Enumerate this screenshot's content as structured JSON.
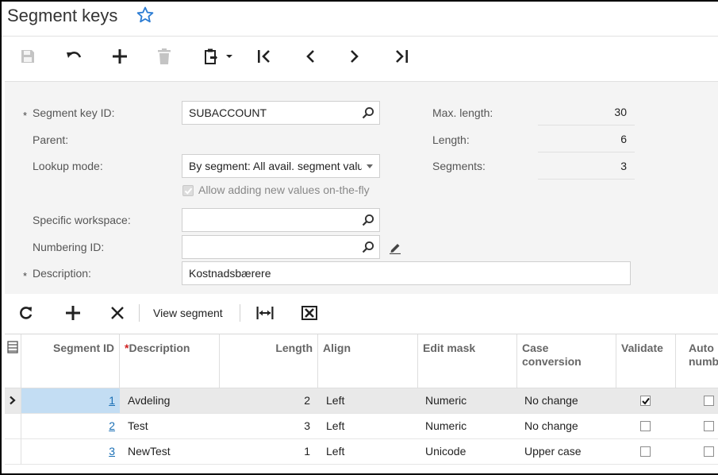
{
  "page": {
    "title": "Segment keys",
    "favorite_icon": "star-outline-icon"
  },
  "toolbar": {
    "buttons": [
      "save-icon",
      "undo-icon",
      "add-icon",
      "delete-icon",
      "clipboard-icon",
      "first-record-icon",
      "previous-record-icon",
      "next-record-icon",
      "last-record-icon"
    ]
  },
  "form": {
    "segment_key_id_label": "Segment key ID:",
    "segment_key_id_value": "SUBACCOUNT",
    "parent_label": "Parent:",
    "lookup_mode_label": "Lookup mode:",
    "lookup_mode_value": "By segment: All avail. segment values",
    "allow_new_values_label": "Allow adding new values on-the-fly",
    "allow_new_values_checked": true,
    "specific_workspace_label": "Specific workspace:",
    "specific_workspace_value": "",
    "numbering_id_label": "Numbering ID:",
    "numbering_id_value": "",
    "description_label": "Description:",
    "description_value": "Kostnadsbærere",
    "required_marker": "*",
    "max_length_label": "Max. length:",
    "max_length_value": "30",
    "length_label": "Length:",
    "length_value": "6",
    "segments_label": "Segments:",
    "segments_value": "3"
  },
  "grid_toolbar": {
    "view_segment_label": "View segment"
  },
  "grid": {
    "columns": {
      "segment_id": "Segment ID",
      "description_marker": "*",
      "description": "Description",
      "length": "Length",
      "align": "Align",
      "edit_mask": "Edit mask",
      "case_conversion_1": "Case",
      "case_conversion_2": "conversion",
      "validate": "Validate",
      "auto_number_1": "Auto",
      "auto_number_2": "number"
    },
    "rows": [
      {
        "segment_id": "1",
        "description": "Avdeling",
        "length": "2",
        "align": "Left",
        "edit_mask": "Numeric",
        "case_conversion": "No change",
        "validate": true,
        "auto_number": false
      },
      {
        "segment_id": "2",
        "description": "Test",
        "length": "3",
        "align": "Left",
        "edit_mask": "Numeric",
        "case_conversion": "No change",
        "validate": false,
        "auto_number": false
      },
      {
        "segment_id": "3",
        "description": "NewTest",
        "length": "1",
        "align": "Left",
        "edit_mask": "Unicode",
        "case_conversion": "Upper case",
        "validate": false,
        "auto_number": false
      }
    ]
  }
}
